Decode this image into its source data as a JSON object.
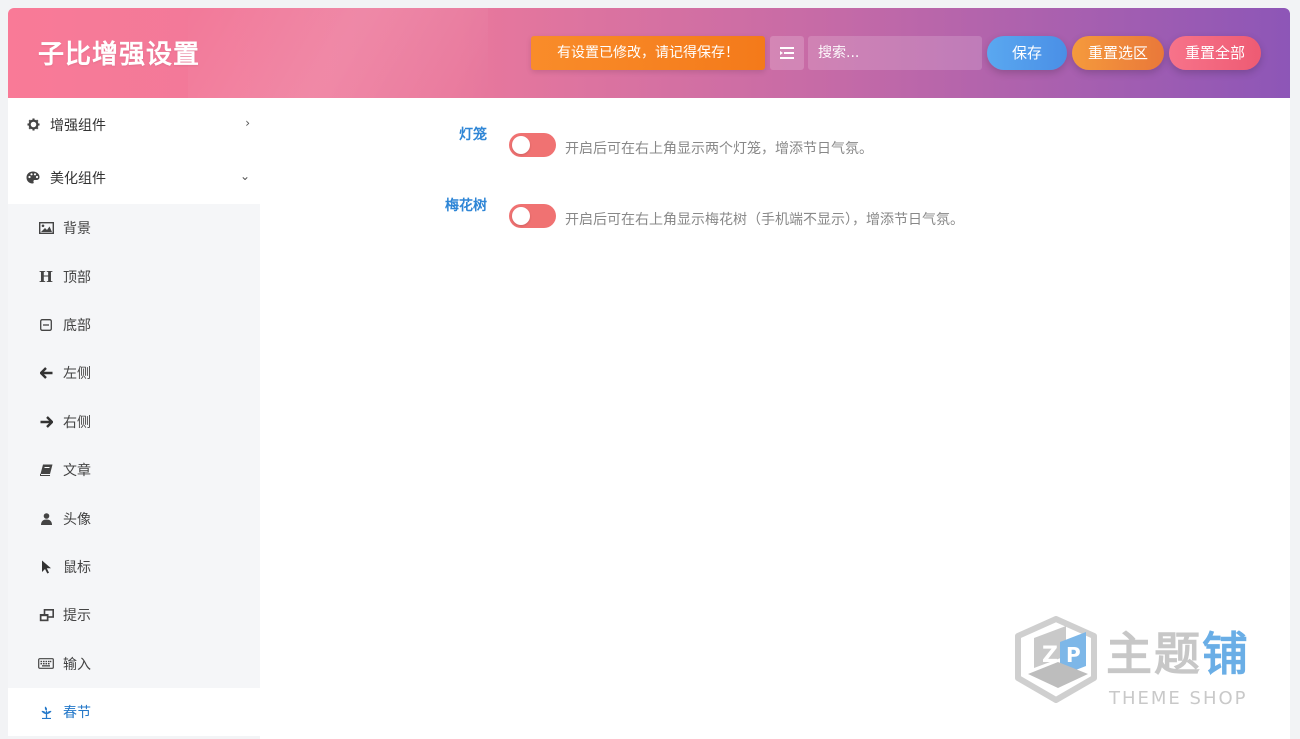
{
  "header": {
    "title": "子比增强设置",
    "notice": "有设置已修改，请记得保存！",
    "search_placeholder": "搜索...",
    "save_label": "保存",
    "reset_section_label": "重置选区",
    "reset_all_label": "重置全部"
  },
  "sidebar": {
    "groups": [
      {
        "label": "增强组件",
        "icon": "gear-icon",
        "expanded": false
      },
      {
        "label": "美化组件",
        "icon": "palette-icon",
        "expanded": true
      }
    ],
    "items": [
      {
        "label": "背景",
        "icon": "image-icon"
      },
      {
        "label": "顶部",
        "icon": "header-icon"
      },
      {
        "label": "底部",
        "icon": "footer-icon"
      },
      {
        "label": "左侧",
        "icon": "arrow-left-icon"
      },
      {
        "label": "右侧",
        "icon": "arrow-right-icon"
      },
      {
        "label": "文章",
        "icon": "book-icon"
      },
      {
        "label": "头像",
        "icon": "user-icon"
      },
      {
        "label": "鼠标",
        "icon": "cursor-icon"
      },
      {
        "label": "提示",
        "icon": "windows-icon"
      },
      {
        "label": "输入",
        "icon": "keyboard-icon"
      },
      {
        "label": "春节",
        "icon": "leaf-icon",
        "active": true
      }
    ]
  },
  "settings": [
    {
      "label": "灯笼",
      "enabled": false,
      "description": "开启后可在右上角显示两个灯笼，增添节日气氛。"
    },
    {
      "label": "梅花树",
      "enabled": false,
      "description": "开启后可在右上角显示梅花树（手机端不显示），增添节日气氛。"
    }
  ],
  "watermark": {
    "text_gray": "主题",
    "text_blue": "铺",
    "subtitle": "THEME SHOP"
  },
  "colors": {
    "accent_blue": "#2f86d6",
    "toggle_off": "#f07272",
    "notice_orange": "#f47a1a"
  }
}
